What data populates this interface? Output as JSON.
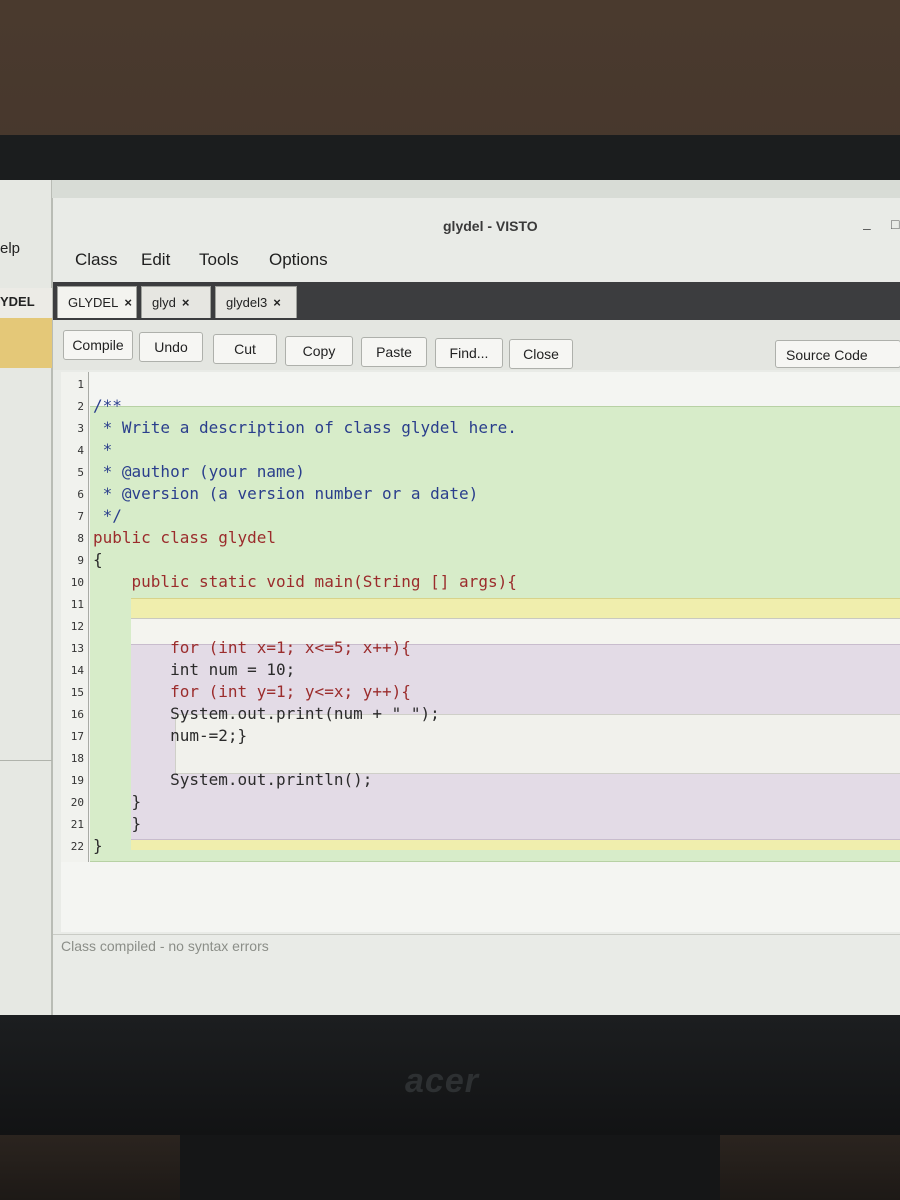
{
  "window": {
    "title": "glydel - VISTO",
    "controls": [
      "–",
      "□"
    ]
  },
  "background_window": {
    "menu_fragment": "elp",
    "tab_fragment": "YDEL"
  },
  "menubar": {
    "items": [
      "Class",
      "Edit",
      "Tools",
      "Options"
    ]
  },
  "tabs": [
    {
      "label": "GLYDEL",
      "close": "×"
    },
    {
      "label": "glyd",
      "close": "×"
    },
    {
      "label": "glydel3",
      "close": "×"
    }
  ],
  "toolbar": {
    "buttons": [
      "Compile",
      "Undo",
      "Cut",
      "Copy",
      "Paste",
      "Find...",
      "Close"
    ],
    "view_select": "Source Code"
  },
  "editor": {
    "line_numbers": [
      "1",
      "2",
      "3",
      "4",
      "5",
      "6",
      "7",
      "8",
      "9",
      "10",
      "11",
      "12",
      "13",
      "14",
      "15",
      "16",
      "17",
      "18",
      "19",
      "20",
      "21",
      "22"
    ],
    "lines": [
      "",
      "/**",
      " * Write a description of class glydel here.",
      " *",
      " * @author (your name)",
      " * @version (a version number or a date)",
      " */",
      "public class glydel",
      "{",
      "    public static void main(String [] args){",
      "",
      "",
      "        for (int x=1; x<=5; x++){",
      "        int num = 10;",
      "        for (int y=1; y<=x; y++){",
      "        System.out.print(num + \" \");",
      "        num-=2;}",
      "",
      "        System.out.println();",
      "    }",
      "    }",
      "}"
    ]
  },
  "status": {
    "message": "Class compiled - no syntax errors"
  },
  "monitor": {
    "brand": "acer"
  }
}
